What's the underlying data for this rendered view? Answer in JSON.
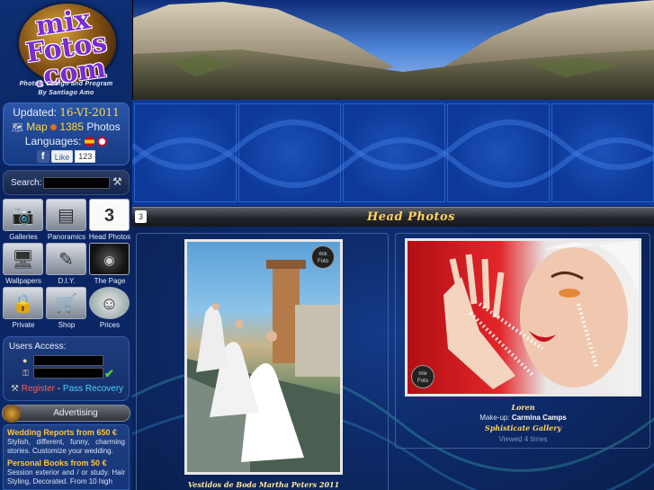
{
  "logo": {
    "text": "mix Fotos .com",
    "subtitle1": "Photos, Design and Program",
    "subtitle2": "By Santiago Amo"
  },
  "info": {
    "updated_label": "Updated:",
    "updated_date": "16-VI-2011",
    "map_label": "Map",
    "photo_count": "1385",
    "photos_label": "Photos",
    "languages_label": "Languages:",
    "fb_like": "Like",
    "fb_count": "123"
  },
  "search": {
    "label": "Search:"
  },
  "menu": [
    {
      "label": "Galleries",
      "icon": "gallery-icon"
    },
    {
      "label": "Panoramics",
      "icon": "panorama-icon"
    },
    {
      "label": "Head Photos",
      "icon": "calendar-icon"
    },
    {
      "label": "Wallpapers",
      "icon": "monitor-icon"
    },
    {
      "label": "D.I.Y.",
      "icon": "pencil-icon"
    },
    {
      "label": "The Page",
      "icon": "logo-icon"
    },
    {
      "label": "Private",
      "icon": "user-lock-icon"
    },
    {
      "label": "Shop",
      "icon": "cart-icon"
    },
    {
      "label": "Prices",
      "icon": "smiley-icon"
    }
  ],
  "users": {
    "title": "Users Access:",
    "register": "Register",
    "separator": "-",
    "recovery": "Pass Recovery"
  },
  "advertising": {
    "label": "Advertising"
  },
  "promos": [
    {
      "title": "Wedding Reports from 650 €",
      "text": "Stylish, different, funny, charming stories. Customize your wedding."
    },
    {
      "title": "Personal Books from 50 €",
      "text": "Session exterior and / or study. Hair Styling, Decorated. From 10 high"
    }
  ],
  "section": {
    "number": "3",
    "title": "Head Photos"
  },
  "photos": [
    {
      "caption": "Vestidos de Boda Martha Peters 2011"
    },
    {
      "caption": "Loren",
      "makeup_label": "Make-up:",
      "makeup_name": "Carmina Camps",
      "gallery": "Sphisticate Gallery",
      "views": "Viewed 4 times"
    }
  ],
  "colors": {
    "accent_gold": "#ffd25a",
    "link_red": "#ff5a5a",
    "link_cyan": "#4bd1ff",
    "background": "#0d1f4a"
  }
}
